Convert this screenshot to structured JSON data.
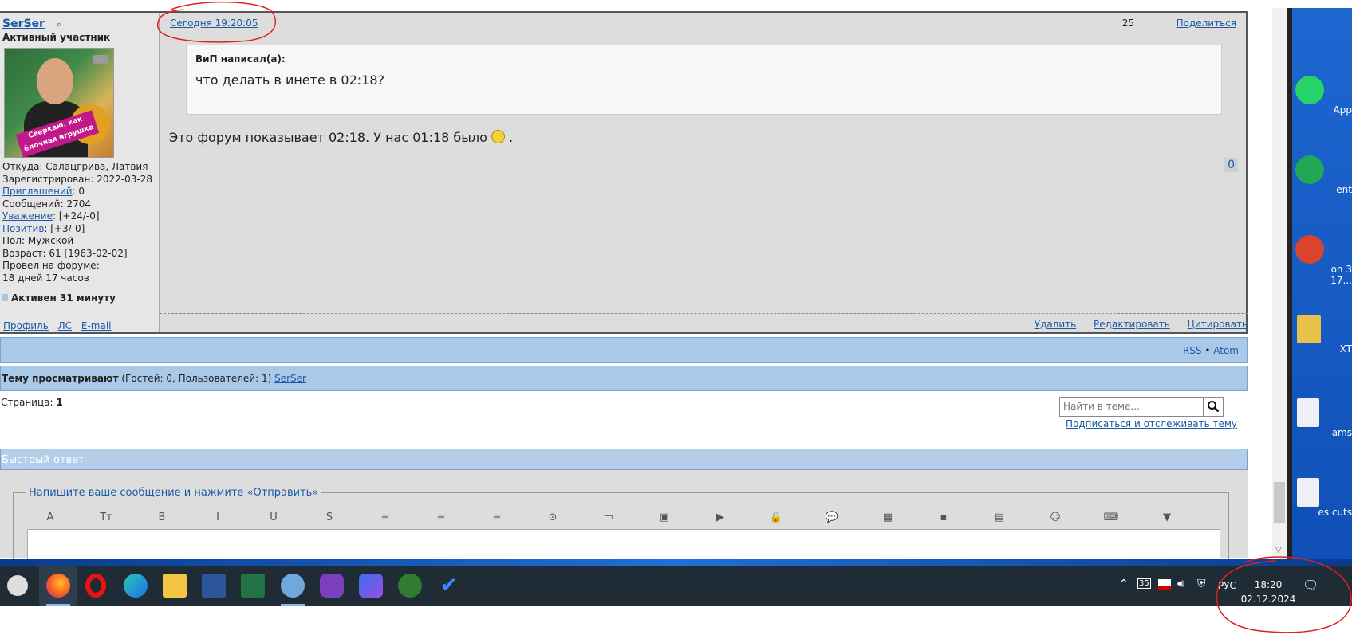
{
  "author": {
    "name": "SerSer",
    "role": "Активный участник",
    "avatar_badge": "Сверкаю, как ёлочная игрушка",
    "avatar_more": "...",
    "from": "Откуда: Салацгрива, Латвия",
    "registered": "Зарегистрирован: 2022-03-28",
    "invites_label": "Приглашений",
    "invites_value": ": 0",
    "posts": "Сообщений: 2704",
    "respect_label": "Уважение",
    "respect_value": ": [+24/-0]",
    "positive_label": "Позитив",
    "positive_value": ": [+3/-0]",
    "gender": "Пол: Мужской",
    "age": "Возраст: 61 [1963-02-02]",
    "time_on_forum_label": "Провел на форуме:",
    "time_on_forum_value": "18 дней 17 часов",
    "active": "Активен 31 минуту",
    "links": {
      "profile": "Профиль",
      "pm": "ЛС",
      "email": "E-mail"
    }
  },
  "post": {
    "time": "Сегодня 19:20:05",
    "number": "25",
    "share": "Поделиться",
    "quote_author": "ВиП написал(а):",
    "quote_text": "что делать в инете в 02:18?",
    "message_before": "Это форум показывает 02:18. У нас 01:18 было",
    "message_after": ".",
    "likes": "0",
    "actions": {
      "delete": "Удалить",
      "edit": "Редактировать",
      "quote": "Цитировать"
    }
  },
  "feeds": {
    "rss": "RSS",
    "sep": "•",
    "atom": "Atom"
  },
  "viewers": {
    "label": "Тему просматривают",
    "counts": "(Гостей: 0, Пользователей: 1)",
    "user": "SerSer"
  },
  "pagination": {
    "label": "Страница:",
    "current": "1"
  },
  "search": {
    "placeholder": "Найти в теме..."
  },
  "subscribe": "Подписаться и отслеживать тему",
  "quick_reply": {
    "title": "Быстрый ответ",
    "legend": "Напишите ваше сообщение и нажмите «Отправить»",
    "toolbar_glyphs": [
      "A",
      "Tт",
      "B",
      "I",
      "U",
      "S",
      "≡",
      "≡",
      "≡",
      "⊙",
      "▭",
      "▣",
      "▶",
      "🔒",
      "💬",
      "▦",
      "▪",
      "▤",
      "☺",
      "⌨",
      "▼"
    ]
  },
  "desktop_icons": [
    "App",
    "ent",
    "on 3",
    "17...",
    "XT",
    "ams",
    "es cuts"
  ],
  "tray": {
    "temp": "35",
    "lang": "РУС",
    "time": "18:20",
    "date": "02.12.2024"
  },
  "colors": {
    "accent_link": "#1a5aa6",
    "bar_blue": "#aac8e8",
    "annotation_red": "#e02020"
  }
}
